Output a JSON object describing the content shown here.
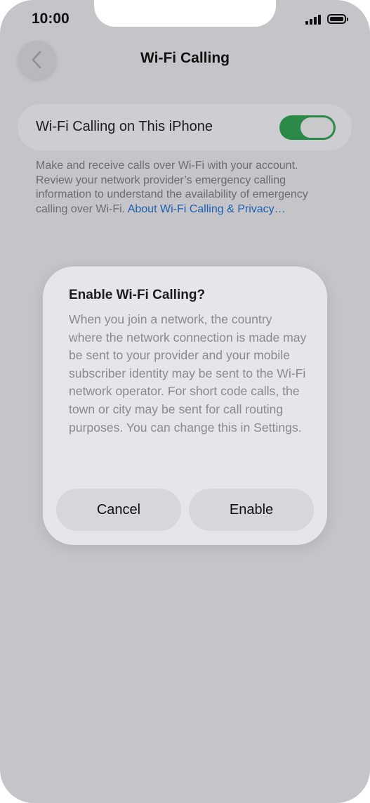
{
  "status_bar": {
    "time": "10:00"
  },
  "nav": {
    "title": "Wi-Fi Calling"
  },
  "setting": {
    "label": "Wi-Fi Calling on This iPhone",
    "toggle_state": "on"
  },
  "footer": {
    "text": "Make and receive calls over Wi-Fi with your account. Review your network provider’s emergency calling information to understand the availability of emergency calling over Wi-Fi. ",
    "link": "About Wi-Fi Calling & Privacy…"
  },
  "dialog": {
    "title": "Enable Wi-Fi Calling?",
    "body": "When you join a network, the country where the network connection is made may be sent to your provider and your mobile subscriber identity may be sent to the Wi-Fi network operator. For short code calls, the town or city may be sent for call routing purposes. You can change this in Settings.",
    "cancel_label": "Cancel",
    "enable_label": "Enable"
  },
  "colors": {
    "toggle_on": "#2b8a47",
    "link": "#1d5fb0"
  }
}
